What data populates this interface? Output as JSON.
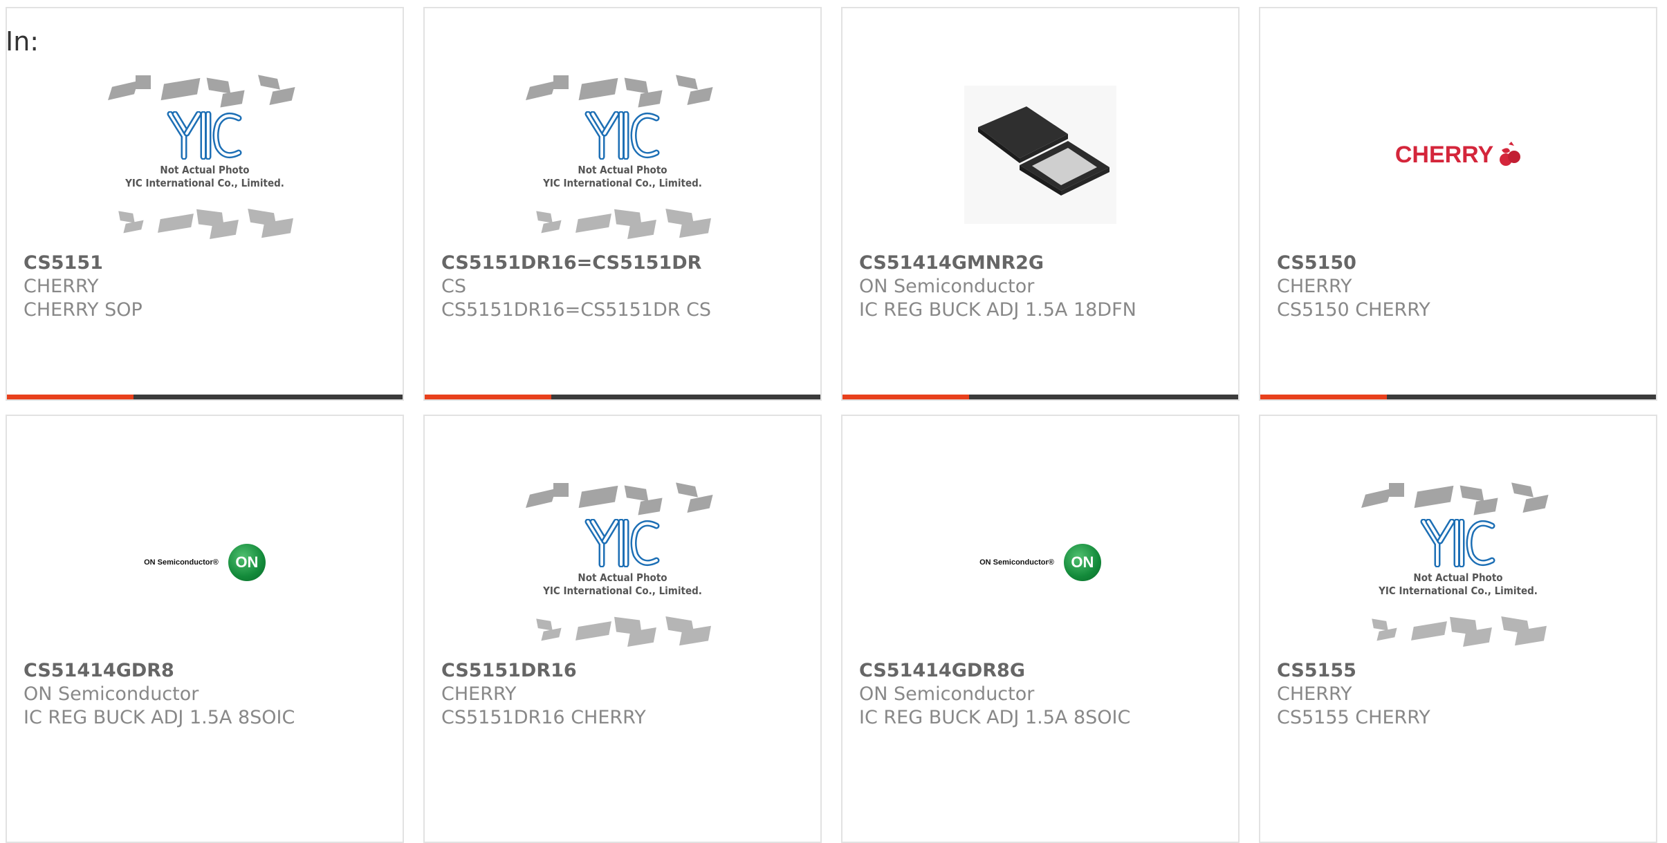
{
  "filter_label": "In:",
  "colors": {
    "accent": "#e8401c",
    "bar": "#3b3b3b",
    "border": "#e2e2e2",
    "cherry_red": "#d4263b",
    "on_green": "#138a3a"
  },
  "placeholder_caption": [
    "Not Actual Photo",
    "YIC International Co., Limited."
  ],
  "products": [
    {
      "part": "CS5151",
      "manufacturer": "CHERRY",
      "description": "CHERRY SOP",
      "image": "yic-placeholder-icon"
    },
    {
      "part": "CS5151DR16=CS5151DR",
      "manufacturer": "CS",
      "description": "CS5151DR16=CS5151DR CS",
      "image": "yic-placeholder-icon"
    },
    {
      "part": "CS51414GMNR2G",
      "manufacturer": "ON Semiconductor",
      "description": "IC REG BUCK ADJ 1.5A 18DFN",
      "image": "dfn-chip-icon"
    },
    {
      "part": "CS5150",
      "manufacturer": "CHERRY",
      "description": "CS5150 CHERRY",
      "image": "cherry-logo-icon",
      "logo_text": "CHERRY"
    },
    {
      "part": "CS51414GDR8",
      "manufacturer": "ON Semiconductor",
      "description": "IC REG BUCK ADJ 1.5A 8SOIC",
      "image": "on-semi-logo-icon",
      "logo_text": "ON Semiconductor",
      "logo_badge": "ON"
    },
    {
      "part": "CS5151DR16",
      "manufacturer": "CHERRY",
      "description": "CS5151DR16 CHERRY",
      "image": "yic-placeholder-icon"
    },
    {
      "part": "CS51414GDR8G",
      "manufacturer": "ON Semiconductor",
      "description": "IC REG BUCK ADJ 1.5A 8SOIC",
      "image": "on-semi-logo-icon",
      "logo_text": "ON Semiconductor",
      "logo_badge": "ON"
    },
    {
      "part": "CS5155",
      "manufacturer": "CHERRY",
      "description": "CS5155 CHERRY",
      "image": "yic-placeholder-icon"
    }
  ]
}
